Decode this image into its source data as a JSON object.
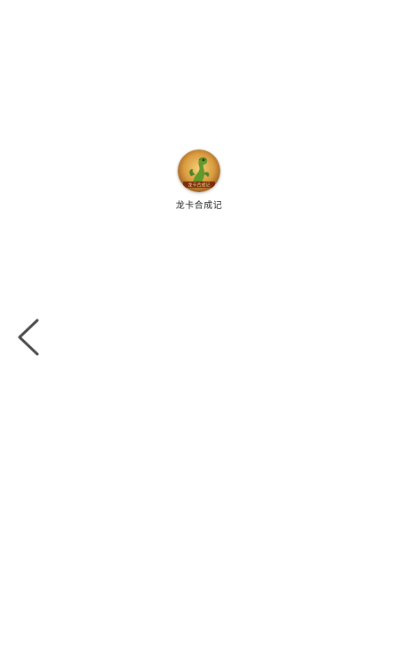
{
  "app": {
    "name": "龙卡合成记",
    "icon_banner_text": "龙卡合成记",
    "icon": "dragon-game-icon"
  },
  "navigation": {
    "back_icon": "chevron-left-icon"
  },
  "colors": {
    "background": "#ffffff",
    "icon_bg_outer": "#b8742a",
    "icon_bg_inner": "#f3c15a",
    "dragon_green": "#5f9a2a",
    "banner": "#7a2d0e"
  }
}
